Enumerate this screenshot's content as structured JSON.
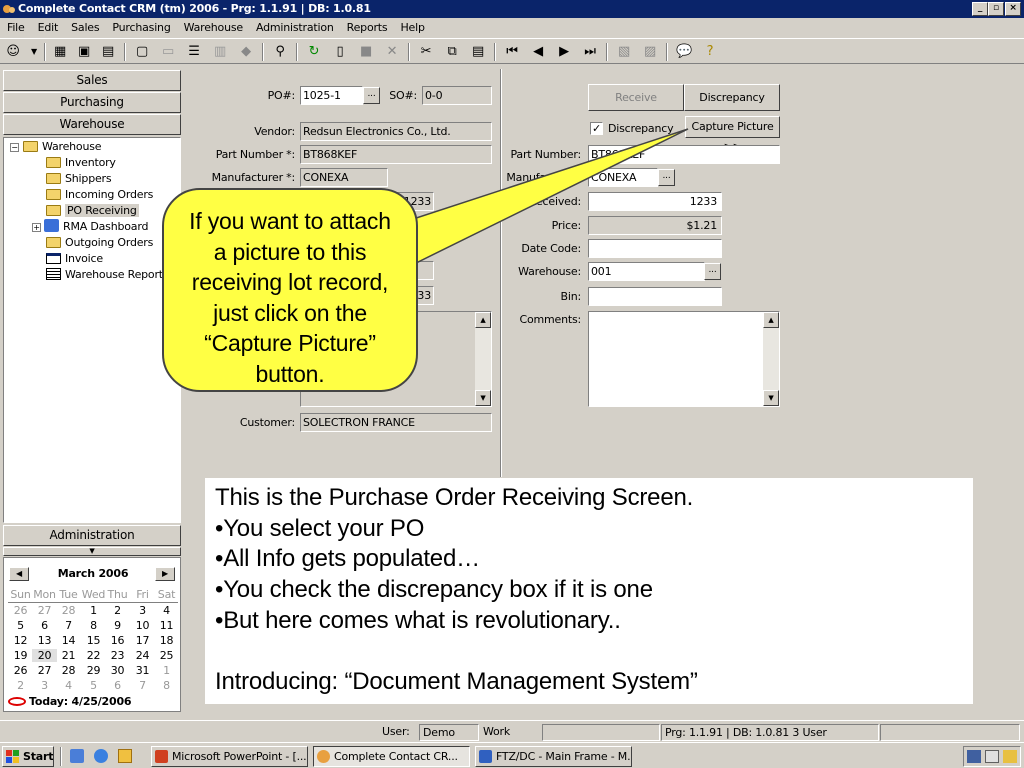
{
  "window": {
    "title": "Complete Contact CRM (tm) 2006 - Prg: 1.1.91 | DB: 1.0.81"
  },
  "menu": [
    "File",
    "Edit",
    "Sales",
    "Purchasing",
    "Warehouse",
    "Administration",
    "Reports",
    "Help"
  ],
  "nav": {
    "sales": "Sales",
    "purchasing": "Purchasing",
    "warehouse": "Warehouse",
    "administration": "Administration",
    "tree": {
      "root": "Warehouse",
      "items": [
        "Inventory",
        "Shippers",
        "Incoming Orders",
        "PO Receiving",
        "RMA Dashboard",
        "Outgoing Orders",
        "Invoice",
        "Warehouse Reports"
      ]
    }
  },
  "calendar": {
    "month": "March 2006",
    "days": [
      "Sun",
      "Mon",
      "Tue",
      "Wed",
      "Thu",
      "Fri",
      "Sat"
    ],
    "weeks": [
      [
        "26",
        "27",
        "28",
        "1",
        "2",
        "3",
        "4"
      ],
      [
        "5",
        "6",
        "7",
        "8",
        "9",
        "10",
        "11"
      ],
      [
        "12",
        "13",
        "14",
        "15",
        "16",
        "17",
        "18"
      ],
      [
        "19",
        "20",
        "21",
        "22",
        "23",
        "24",
        "25"
      ],
      [
        "26",
        "27",
        "28",
        "29",
        "30",
        "31",
        "1"
      ],
      [
        "2",
        "3",
        "4",
        "5",
        "6",
        "7",
        "8"
      ]
    ],
    "today": "Today: 4/25/2006"
  },
  "form": {
    "po_label": "PO#:",
    "po_value": "1025-1",
    "so_label": "SO#:",
    "so_value": "0-0",
    "vendor_label": "Vendor:",
    "vendor_value": "Redsun Electronics Co., Ltd.",
    "part_label": "Part Number *:",
    "part_value": "BT868KEF",
    "mfr_label": "Manufacturer *:",
    "mfr_value": "CONEXA",
    "qty1_value": "1233",
    "qty2_value": "1233",
    "customer_label": "Customer:",
    "customer_value": "SOLECTRON FRANCE",
    "receive_btn": "Receive",
    "discrepancy_btn": "Discrepancy",
    "discrepancy_check": "Discrepancy",
    "capture_btn": "Capture Picture >>",
    "r_part_label": "Part Number:",
    "r_part_value": "BT868KEF",
    "r_mfr_label": "Manufacturer:",
    "r_mfr_value": "CONEXA",
    "r_received_label": "Received:",
    "r_received_value": "1233",
    "r_price_label": "Price:",
    "r_price_value": "$1.21",
    "r_datecode_label": "Date Code:",
    "r_warehouse_label": "Warehouse:",
    "r_warehouse_value": "001",
    "r_bin_label": "Bin:",
    "r_comments_label": "Comments:"
  },
  "callout": "If you want to attach a picture to this receiving lot record, just click on the “Capture Picture” button.",
  "overlay": [
    "This is the Purchase Order Receiving Screen.",
    "•You select your PO",
    "•All Info gets populated…",
    "•You check the discrepancy box if it is one",
    "•But here comes what is revolutionary..",
    "",
    "Introducing: “Document Management System”"
  ],
  "status": {
    "user_label": "User:",
    "user_value": "Demo",
    "workdate_label": "Work Date:",
    "version": "Prg: 1.1.91 | DB: 1.0.81 3 User"
  },
  "taskbar": {
    "start": "Start",
    "tasks": [
      "Microsoft PowerPoint - [...",
      "Complete Contact CR...",
      "FTZ/DC - Main Frame - M..."
    ]
  }
}
